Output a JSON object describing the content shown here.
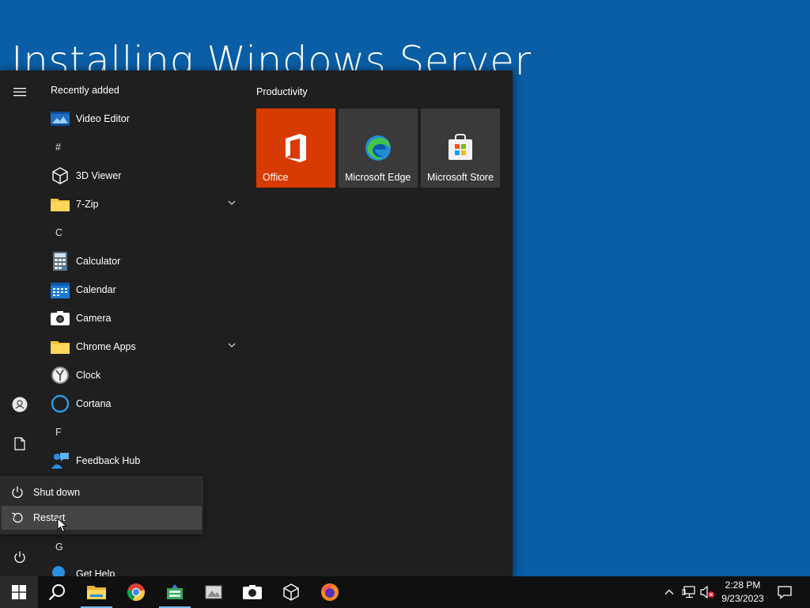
{
  "desktop": {
    "title": "Installing Windows Server",
    "background": "#0a5ea6"
  },
  "start_menu": {
    "section_label": "Recently added",
    "apps": [
      {
        "label": "Video Editor",
        "icon": "video-editor-icon"
      },
      {
        "header": "#"
      },
      {
        "label": "3D Viewer",
        "icon": "3d-viewer-icon"
      },
      {
        "label": "7-Zip",
        "icon": "folder-icon",
        "expandable": true
      },
      {
        "header": "C"
      },
      {
        "label": "Calculator",
        "icon": "calculator-icon"
      },
      {
        "label": "Calendar",
        "icon": "calendar-icon"
      },
      {
        "label": "Camera",
        "icon": "camera-icon"
      },
      {
        "label": "Chrome Apps",
        "icon": "folder-icon",
        "expandable": true
      },
      {
        "label": "Clock",
        "icon": "clock-icon"
      },
      {
        "label": "Cortana",
        "icon": "cortana-icon"
      },
      {
        "header": "F"
      },
      {
        "label": "Feedback Hub",
        "icon": "feedback-hub-icon"
      },
      {
        "header": "G"
      },
      {
        "label": "Get Help",
        "icon": "get-help-icon"
      }
    ],
    "tiles_group": "Productivity",
    "tiles": [
      {
        "label": "Office",
        "color": "#d83b01"
      },
      {
        "label": "Microsoft Edge",
        "color": "#3a3a3a"
      },
      {
        "label": "Microsoft Store",
        "color": "#3a3a3a"
      }
    ]
  },
  "power_menu": {
    "items": [
      {
        "label": "Shut down",
        "icon": "power-icon"
      },
      {
        "label": "Restart",
        "icon": "restart-icon",
        "hovered": true
      }
    ]
  },
  "taskbar": {
    "apps": [
      "start-icon",
      "search-icon",
      "file-explorer-icon",
      "chrome-icon",
      "task-app-icon",
      "photos-icon",
      "camera-icon",
      "3d-viewer-icon",
      "firefox-icon"
    ],
    "clock_time": "2:28 PM",
    "clock_date": "9/23/2023"
  }
}
